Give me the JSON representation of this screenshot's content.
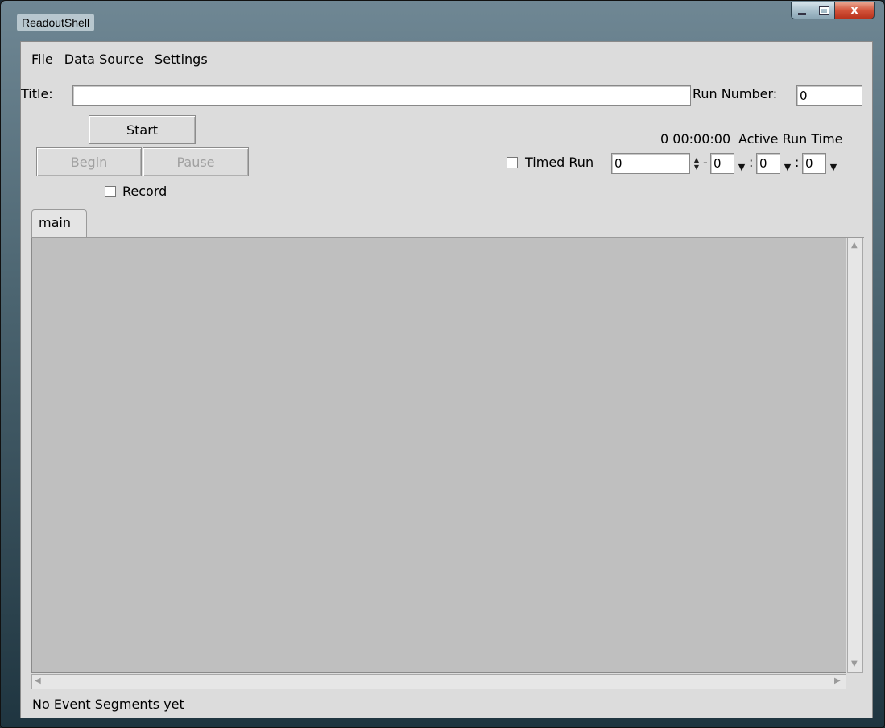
{
  "window": {
    "title": "ReadoutShell",
    "close_glyph": "x"
  },
  "menu": [
    "File",
    "Data Source",
    "Settings"
  ],
  "title_field": {
    "label": "Title:",
    "value": ""
  },
  "run_number": {
    "label": "Run Number:",
    "value": "0"
  },
  "buttons": {
    "start": "Start",
    "begin": "Begin",
    "pause": "Pause"
  },
  "record_label": "Record",
  "elapsed": {
    "value": "0 00:00:00",
    "label": "Active Run Time"
  },
  "timed_run": {
    "label": "Timed Run",
    "days": "0",
    "hours": "0",
    "minutes": "0",
    "seconds": "0"
  },
  "separators": {
    "dash": "-",
    "colon": ":"
  },
  "tabs": [
    "main"
  ],
  "status": "No Event Segments yet",
  "icons": [
    "minimize-icon",
    "maximize-icon",
    "close-icon",
    "spin-up-icon",
    "spin-down-icon",
    "chevron-down-icon",
    "scroll-up-icon",
    "scroll-down-icon",
    "scroll-left-icon",
    "scroll-right-icon"
  ]
}
